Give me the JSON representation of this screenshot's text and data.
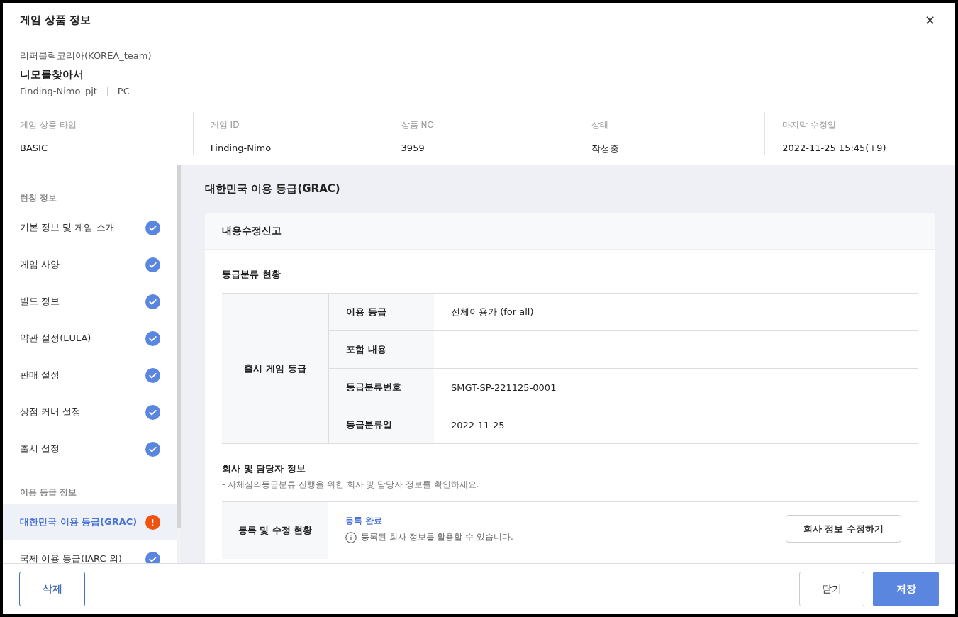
{
  "window": {
    "title": "게임 상품 정보",
    "close": "✕"
  },
  "product": {
    "company": "리퍼블릭코리아(KOREA_team)",
    "name": "니모를찾아서",
    "project": "Finding-Nimo_pjt",
    "platform": "PC"
  },
  "meta": [
    {
      "label": "게임 상품 타입",
      "value": "BASIC"
    },
    {
      "label": "게임 ID",
      "value": "Finding-Nimo"
    },
    {
      "label": "상품 NO",
      "value": "3959"
    },
    {
      "label": "상태",
      "value": "작성중"
    },
    {
      "label": "마지막 수정일",
      "value": "2022-11-25 15:45(+9)"
    }
  ],
  "sidebar": {
    "groups": [
      {
        "title": "런칭 정보",
        "items": [
          {
            "label": "기본 정보 및 게임 소개",
            "kind": "done",
            "selected": false
          },
          {
            "label": "게임 사양",
            "kind": "done",
            "selected": false
          },
          {
            "label": "빌드 정보",
            "kind": "done",
            "selected": false
          },
          {
            "label": "약관 설정(EULA)",
            "kind": "done",
            "selected": false
          },
          {
            "label": "판매 설정",
            "kind": "done",
            "selected": false
          },
          {
            "label": "상점 커버 설정",
            "kind": "done",
            "selected": false
          },
          {
            "label": "출시 설정",
            "kind": "done",
            "selected": false
          }
        ]
      },
      {
        "title": "이용 등급 정보",
        "items": [
          {
            "label": "대한민국 이용 등급(GRAC)",
            "kind": "warning",
            "selected": true
          },
          {
            "label": "국제 이용 등급(IARC 외)",
            "kind": "done",
            "selected": false
          }
        ]
      }
    ]
  },
  "content": {
    "title": "대한민국 이용 등급(GRAC)",
    "card_title": "내용수정신고",
    "rating_section": {
      "title": "등급분류 현황",
      "group_label": "출시 게임 등급",
      "rows": [
        {
          "label": "이용 등급",
          "value": "전체이용가 (for all)"
        },
        {
          "label": "포함 내용"
        },
        {
          "label": "등급분류번호",
          "value": "SMGT-SP-221125-0001"
        },
        {
          "label": "등급분류일",
          "value": "2022-11-25"
        }
      ]
    },
    "company_section": {
      "title": "회사 및 담당자 정보",
      "description": "- 자체심의등급분류 진행을 위한 회사 및 담당자 정보를 확인하세요.",
      "row_label": "등록 및 수정 현황",
      "status": "등록 완료",
      "note": "등록된 회사 정보를 활용할 수 있습니다.",
      "button": "회사 정보 수정하기"
    }
  },
  "footer": {
    "delete": "삭제",
    "close": "닫기",
    "save": "저장"
  }
}
